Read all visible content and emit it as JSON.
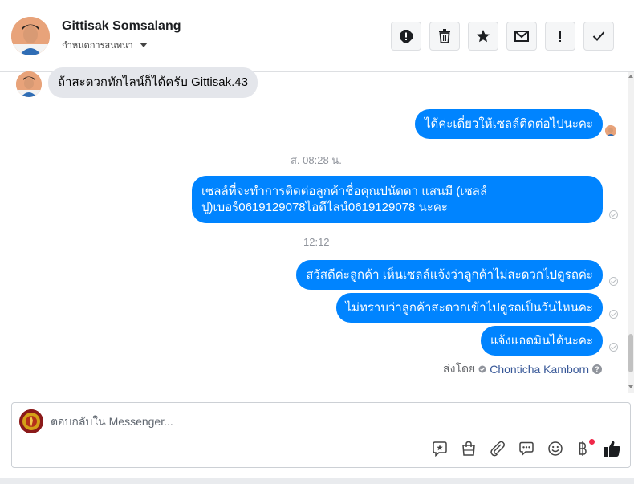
{
  "contact": {
    "name": "Gittisak Somsalang",
    "subtitle": "กำหนดการสนทนา"
  },
  "header_actions": [
    {
      "name": "report-icon"
    },
    {
      "name": "trash-icon"
    },
    {
      "name": "star-icon"
    },
    {
      "name": "mail-icon"
    },
    {
      "name": "exclamation-icon"
    },
    {
      "name": "check-icon"
    }
  ],
  "messages": {
    "incoming_1": "ถ้าสะดวกทักไลน์ก็ได้ครับ Gittisak.43",
    "outgoing_1": "ได้ค่ะเดี๋ยวให้เซลล์ติดต่อไปนะคะ",
    "timestamp_1": "ส. 08:28 น.",
    "outgoing_2_line1": "เซลล์ที่จะทำการติดต่อลูกค้าชื่อคุณปนัดดา แสนมี (เซลล์",
    "outgoing_2_line2": "ปู)เบอร์0619129078ไอดีไลน์0619129078 นะคะ",
    "timestamp_2": "12:12",
    "outgoing_3": "สวัสดีค่ะลูกค้า เห็นเซลล์แจ้งว่าลูกค้าไม่สะดวกไปดูรถค่ะ",
    "outgoing_4": "ไม่ทราบว่าลูกค้าสะดวกเข้าไปดูรถเป็นวันไหนคะ",
    "outgoing_5": "แจ้งแอดมินได้นะคะ"
  },
  "sent_by": {
    "label": "ส่งโดย",
    "sender": "Chonticha Kamborn"
  },
  "composer": {
    "placeholder": "ตอบกลับใน Messenger...",
    "tools": [
      "sticker-icon",
      "shopping-bag-icon",
      "attachment-icon",
      "saved-reply-icon",
      "emoji-icon",
      "payment-icon",
      "like-icon"
    ]
  },
  "colors": {
    "accent": "#0084ff",
    "incoming_bubble": "#e4e6eb",
    "notification": "#f02849"
  }
}
